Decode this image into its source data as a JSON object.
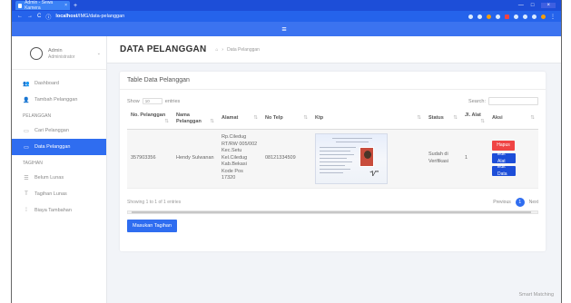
{
  "browser": {
    "tab_title": "Admin - Sewa Kamera",
    "tab_close": "×",
    "new_tab": "+",
    "address_host": "localhost",
    "address_path": "/IMG/data-pelanggan",
    "window_controls": [
      "—",
      "□",
      "×"
    ]
  },
  "sidebar": {
    "profile": {
      "name": "Admin",
      "role": "Administrator"
    },
    "items": [
      {
        "label": "Dashboard",
        "icon": "users-icon"
      },
      {
        "label": "Tambah Pelanggan",
        "icon": "user-plus-icon"
      }
    ],
    "sections": [
      {
        "title": "PELANGGAN",
        "items": [
          {
            "label": "Cari Pelanggan",
            "icon": "search-icon"
          },
          {
            "label": "Data Pelanggan",
            "icon": "database-icon",
            "active": true
          }
        ]
      },
      {
        "title": "TAGIHAN",
        "items": [
          {
            "label": "Belum Lunas",
            "icon": "list-icon"
          },
          {
            "label": "Tagihan Lunas",
            "icon": "receipt-icon"
          },
          {
            "label": "Biaya Tambahan",
            "icon": "plus-list-icon"
          }
        ]
      }
    ]
  },
  "page": {
    "title": "DATA PELANGGAN",
    "breadcrumb": "Data Pelanggan"
  },
  "card": {
    "title": "Table Data Pelanggan",
    "show_label": "Show",
    "show_value": "10",
    "entries_label": "entries",
    "search_label": "Search:",
    "columns": [
      "No. Pelanggan",
      "Nama Pelanggan",
      "Alamat",
      "No Telp",
      "Ktp",
      "Status",
      "Jl. Alat",
      "Aksi"
    ],
    "rows": [
      {
        "no": "357903356",
        "nama": "Hendy Sulwanan",
        "alamat": "Rp.Ciledug RT/RW 005/002 Kec.Setu Kel.Ciledug Kab.Bekasi Kode Pos 17320",
        "telp": "08121334509",
        "status": "Sudah di Verifikasi",
        "jumlah": "1",
        "actions": [
          "Hapus",
          "Edit Alat",
          "Edit Data"
        ]
      }
    ],
    "info": "Showing 1 to 1 of 1 entries",
    "previous": "Previous",
    "page": "1",
    "next": "Next",
    "add_button": "Masukan Tagihan"
  },
  "footer": "Smart Matching"
}
